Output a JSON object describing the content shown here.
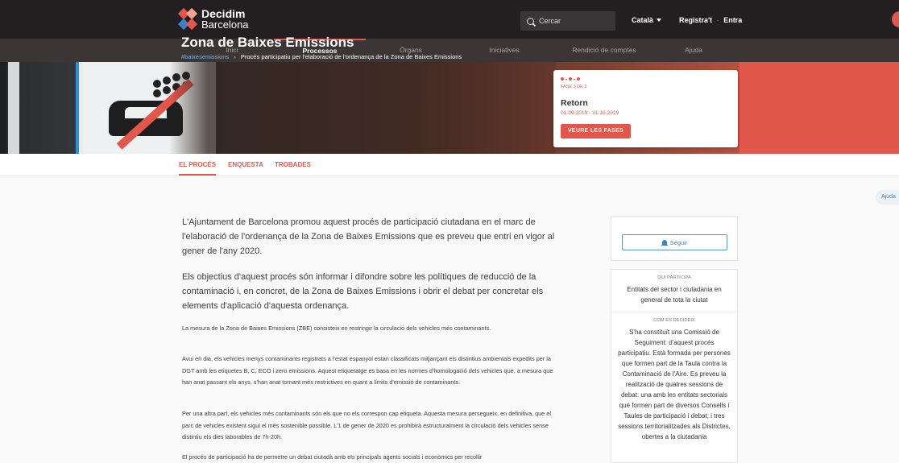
{
  "header": {
    "logo": {
      "line1": "Decidim",
      "line2": "Barcelona"
    },
    "search": {
      "placeholder": "Cercar"
    },
    "language": "Català",
    "register": "Registra't",
    "separator": "·",
    "login": "Entra"
  },
  "nav": {
    "items": [
      {
        "label": "Inici"
      },
      {
        "label": "Processos",
        "active": true
      },
      {
        "label": "Òrgans"
      },
      {
        "label": "Iniciatives"
      },
      {
        "label": "Rendició de comptes"
      },
      {
        "label": "Ajuda"
      }
    ]
  },
  "hero": {
    "title": "Zona de Baixes Emissions",
    "hashtag": "#baixesemissions",
    "arrow": "›",
    "subtitle": "Procés participatiu per l'elaboració de l'ordenança de la Zona de Baixes Emissions"
  },
  "phase": {
    "count": "FASE 3 DE 3",
    "name": "Retorn",
    "dates": "01-09-2019 - 31-10-2019",
    "button": "VEURE LES FASES"
  },
  "tabs": [
    {
      "label": "EL PROCÉS",
      "active": true
    },
    {
      "label": "ENQUESTA"
    },
    {
      "label": "TROBADES"
    }
  ],
  "help_tab": "Ajuda",
  "article": {
    "p1": "L'Ajuntament de Barcelona promou aquest procés de participació ciutadana en el marc de l'elaboració de l'ordenança de la Zona de Baixes Emissions que es preveu que entri en vigor al gener de l'any 2020.",
    "p2": "Els objectius d'aquest procés són informar i difondre sobre les polítiques de reducció de la contaminació i, en concret, de la Zona de Baixes Emissions i obrir el debat per concretar els elements d'aplicació d'aquesta ordenança.",
    "p3": "La mesura de la Zona de Baixes Emissions (ZBE) consisteix en restringir la circulació dels vehicles més contaminants.",
    "p4": "Avui en dia, els vehicles menys contaminants registrats a l'estat espanyol estan classificats mitjançant els distintius ambientals expedits per la DGT amb les etiquetes B, C, ECO i zero emissions. Aquest etiquetatge es basa en les normes d'homologació dels vehicles que, a mesura que han anat passant els anys, s'han anat tornant més restrictives en quant a límits d'emissió de contaminants.",
    "p5": "Per una altra part, els vehicles més contaminants són els que no els correspon cap etiqueta. Aquesta mesura persegueix, en definitiva, que el parc de vehicles existent sigui el més sostenible possible. L'1 de gener de 2020 es prohibirà estructuralment la circulació dels vehicles sense distintiu els dies laborables de 7h-20h.",
    "p6": "El procés de participació ha de permetre un debat ciutadà amb els principals agents socials i econòmics per recollir"
  },
  "sidebar": {
    "follow_button": "Seguir",
    "who_label": "QUI PARTICIPA",
    "who_text": "Entitats del sector i ciutadania en general de tota la ciutat",
    "how_label": "COM ES DECIDEIX",
    "how_text": "S'ha constituït una Comissió de Seguiment: d'aquest procés participatiu. Està formada per persones que formen part de la Taula contra la Contaminació de l'Aire. Es preveu la realització de quatres sessions de debat: una amb les entitats sectorials que formen part de diversos Consells i Taules de participació i debat; i tres sessions territorialitzades als Districtes, obertes a la ciutadania"
  },
  "colors": {
    "accent": "#e2574c",
    "link": "#3b82c4",
    "topbar": "#231f20",
    "nav": "#3b3536"
  }
}
